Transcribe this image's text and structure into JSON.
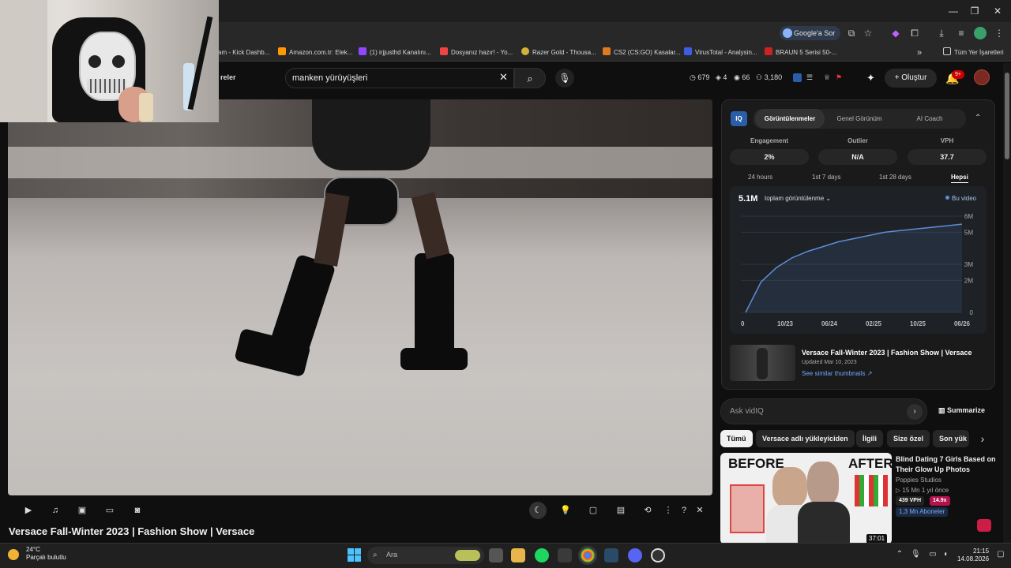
{
  "browser": {
    "search_pill": "Google'a Sor",
    "bookmarks": [
      {
        "label": "am - Kick Dashb...",
        "color": "#53fc18"
      },
      {
        "label": "Amazon.com.tr: Elek...",
        "color": "#ff9900"
      },
      {
        "label": "(1) irjjusthd Kanalını...",
        "color": "#9146ff"
      },
      {
        "label": "Dosyanız hazır! - Yo...",
        "color": "#e44"
      },
      {
        "label": "Razer Gold - Thousa...",
        "color": "#d4b13a"
      },
      {
        "label": "CS2 (CS:GO) Kasalar...",
        "color": "#e07a1f"
      },
      {
        "label": "VirusTotal - Analysin...",
        "color": "#3b5fe0"
      },
      {
        "label": "BRAUN 5 Serisi 50-...",
        "color": "#cc2222"
      }
    ],
    "bookmarks_overflow": "»",
    "all_bookmarks": "Tüm Yer İşaretleri"
  },
  "youtube": {
    "partial_nav": "reler",
    "search_value": "manken yürüyüşleri",
    "stats": {
      "views_today": "679",
      "stat2": "4",
      "stat3": "66",
      "subs": "3,180"
    },
    "create_label": "Oluştur",
    "notif_count": "9+"
  },
  "video": {
    "title": "Versace Fall-Winter 2023 | Fashion Show | Versace"
  },
  "vidiq": {
    "logo": "IQ",
    "tabs": [
      "Görüntülenmeler",
      "Genel Görünüm",
      "AI Coach"
    ],
    "metrics": [
      {
        "label": "Engagement",
        "value": "2%"
      },
      {
        "label": "Outlier",
        "value": "N/A"
      },
      {
        "label": "VPH",
        "value": "37.7"
      }
    ],
    "ranges": [
      "24 hours",
      "1st 7 days",
      "1st 28 days",
      "Hepsi"
    ],
    "total_value": "5.1M",
    "total_dropdown": "toplam görüntülenme ⌄",
    "legend": "Bu video",
    "related": {
      "title": "Versace Fall-Winter 2023 | Fashion Show | Versace",
      "updated": "Updated Mar 10, 2023",
      "similar": "See similar thumbnails ↗"
    },
    "ask_placeholder": "Ask vidIQ",
    "summarize": "Summarize"
  },
  "chart_data": {
    "type": "line",
    "x": [
      "0",
      "10/23",
      "06/24",
      "02/25",
      "10/25",
      "06/26"
    ],
    "y_ticks": [
      "0",
      "2M",
      "3M",
      "5M",
      "6M"
    ],
    "series": [
      {
        "name": "Bu video",
        "values": [
          0.0,
          1.9,
          2.8,
          3.4,
          3.8,
          4.1,
          4.4,
          4.6,
          4.8,
          5.0,
          5.1,
          5.2,
          5.3,
          5.4,
          5.5
        ]
      }
    ],
    "ylim": [
      0,
      6
    ],
    "grid": true,
    "color": "#5b8fd6"
  },
  "chips": [
    "Tümü",
    "Versace adlı yükleyiciden",
    "İlgili",
    "Size özel",
    "Son yük"
  ],
  "recommendation": {
    "thumb_left": "BEFORE",
    "thumb_right": "AFTER",
    "duration": "37:01",
    "title": "Blind Dating 7 Girls Based on Their Glow Up Photos",
    "channel": "Poppies Studios",
    "meta": "▷ 15 Mn   1 yıl önce",
    "vph": "439 VPH",
    "multiplier": "14.9x",
    "subs": "1,3 Mn Aboneler"
  },
  "taskbar": {
    "temp": "24°C",
    "weather": "Parçalı bulutlu",
    "search": "Ara",
    "time": "21:15",
    "date": "14.08.2026"
  }
}
